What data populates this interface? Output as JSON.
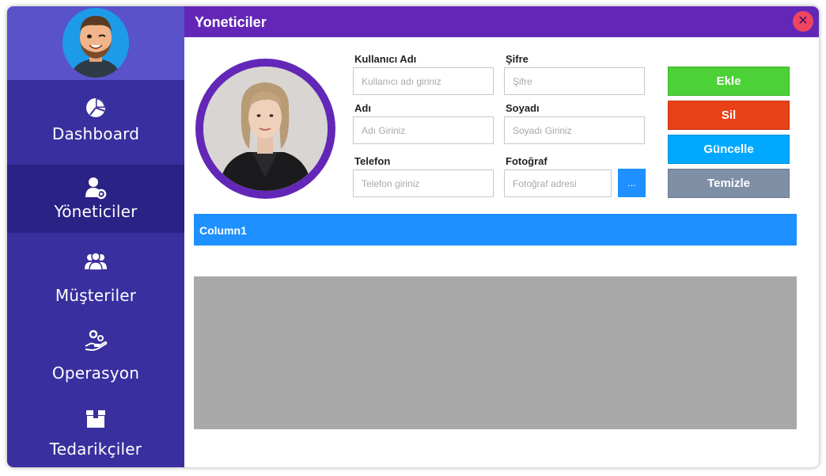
{
  "sidebar": {
    "items": [
      {
        "label": "Dashboard",
        "icon": "pie-chart-icon"
      },
      {
        "label": "Yöneticiler",
        "icon": "user-settings-icon"
      },
      {
        "label": "Müşteriler",
        "icon": "users-icon"
      },
      {
        "label": "Operasyon",
        "icon": "hand-gears-icon"
      },
      {
        "label": "Tedarikçiler",
        "icon": "box-icon"
      }
    ],
    "active_item": "Yöneticiler"
  },
  "header": {
    "title": "Yoneticiler",
    "close_icon": "close-icon"
  },
  "form": {
    "username": {
      "label": "Kullanıcı Adı",
      "placeholder": "Kullanıcı adı giriniz",
      "value": ""
    },
    "password": {
      "label": "Şifre",
      "placeholder": "Şifre",
      "value": ""
    },
    "first_name": {
      "label": "Adı",
      "placeholder": "Adı Giriniz",
      "value": ""
    },
    "last_name": {
      "label": "Soyadı",
      "placeholder": "Soyadı Giriniz",
      "value": ""
    },
    "phone": {
      "label": "Telefon",
      "placeholder": "Telefon giriniz",
      "value": ""
    },
    "photo": {
      "label": "Fotoğraf",
      "placeholder": "Fotoğraf adresi",
      "value": "",
      "browse_label": "..."
    }
  },
  "actions": {
    "add": "Ekle",
    "delete": "Sil",
    "update": "Güncelle",
    "clear": "Temizle"
  },
  "grid": {
    "columns": [
      "Column1"
    ]
  },
  "colors": {
    "sidebar": "#3a2f9e",
    "sidebar_active": "#2a2285",
    "titlebar": "#6327b7",
    "add": "#4cd137",
    "delete": "#e84118",
    "update": "#00a8ff",
    "clear": "#7f8fa6",
    "grid_header": "#1e90ff",
    "grid_body": "#a9a9a9"
  }
}
